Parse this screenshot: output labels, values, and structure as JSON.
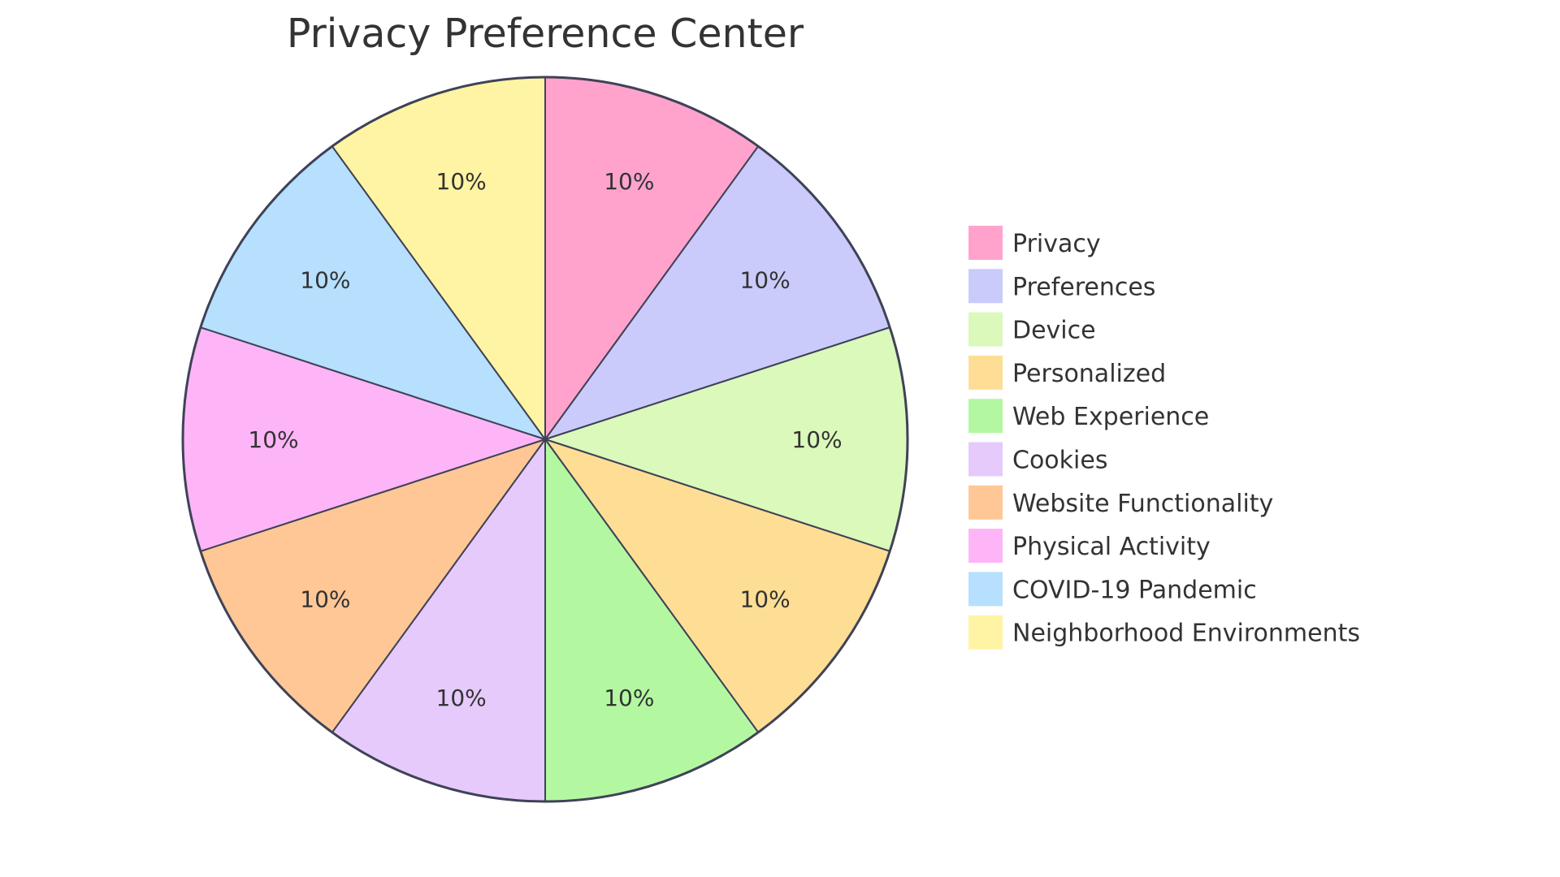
{
  "chart_data": {
    "type": "pie",
    "title": "Privacy Preference Center",
    "categories": [
      "Privacy",
      "Preferences",
      "Device",
      "Personalized",
      "Web Experience",
      "Cookies",
      "Website Functionality",
      "Physical Activity",
      "COVID-19 Pandemic",
      "Neighborhood Environments"
    ],
    "values": [
      10,
      10,
      10,
      10,
      10,
      10,
      10,
      10,
      10,
      10
    ],
    "labels": [
      "10%",
      "10%",
      "10%",
      "10%",
      "10%",
      "10%",
      "10%",
      "10%",
      "10%",
      "10%"
    ],
    "colors": [
      "#FFA3CD",
      "#CACBFB",
      "#DAF9BB",
      "#FEDE95",
      "#B3F8A1",
      "#E6CAFC",
      "#FFC795",
      "#FDB5F7",
      "#B6E0FE",
      "#FFF4A3"
    ],
    "legend": "right",
    "stroke_color": "#3F4257"
  }
}
